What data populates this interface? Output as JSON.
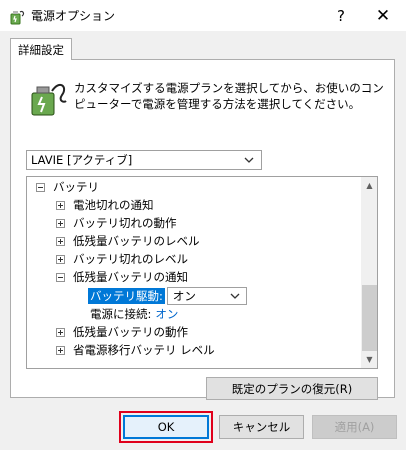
{
  "window": {
    "title": "電源オプション",
    "help_label": "?",
    "close_label": "✕"
  },
  "tab": {
    "label": "詳細設定"
  },
  "description": "カスタマイズする電源プランを選択してから、お使いのコンピューターで電源を管理する方法を選択してください。",
  "plan_select": {
    "value": "LAVIE [アクティブ]"
  },
  "tree": {
    "items": [
      {
        "label": "バッテリ",
        "toggle": "minus"
      },
      {
        "label": "電池切れの通知",
        "toggle": "plus"
      },
      {
        "label": "バッテリ切れの動作",
        "toggle": "plus"
      },
      {
        "label": "低残量バッテリのレベル",
        "toggle": "plus"
      },
      {
        "label": "バッテリ切れのレベル",
        "toggle": "plus"
      },
      {
        "label": "低残量バッテリの通知",
        "toggle": "minus"
      },
      {
        "label": "低残量バッテリの動作",
        "toggle": "plus"
      },
      {
        "label": "省電源移行バッテリ レベル",
        "toggle": "plus"
      }
    ],
    "on_battery": {
      "label": "バッテリ駆動:",
      "value": "オン"
    },
    "plugged_in": {
      "label": "電源に接続:",
      "value": "オン"
    }
  },
  "buttons": {
    "restore": "既定のプランの復元(R)",
    "ok": "OK",
    "cancel": "キャンセル",
    "apply": "適用(A)"
  },
  "colors": {
    "accent": "#0078d7",
    "highlight_box": "#e0001b",
    "link": "#0066cc"
  }
}
